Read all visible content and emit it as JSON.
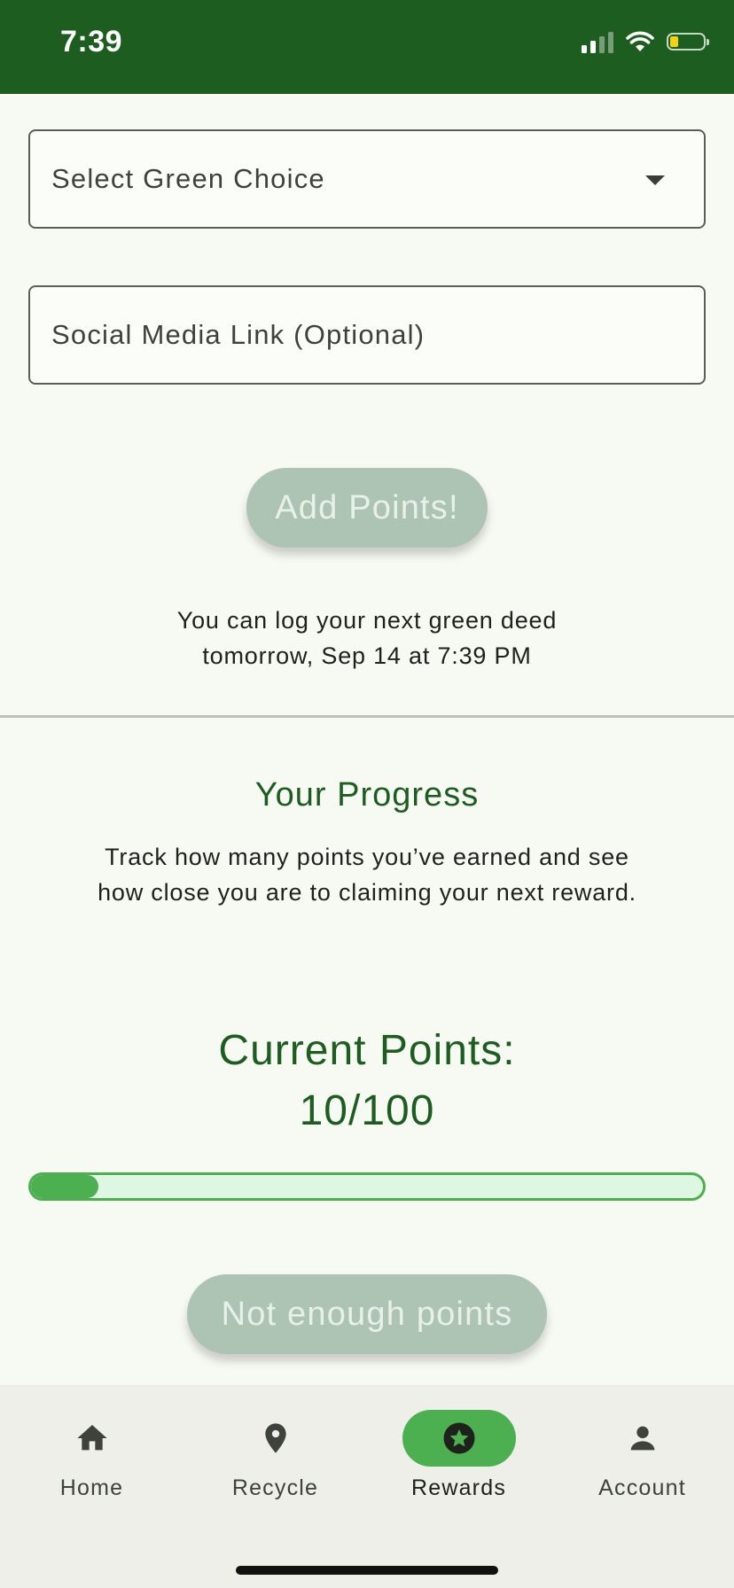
{
  "status_bar": {
    "time": "7:39",
    "icons": [
      "cellular-signal-icon",
      "wifi-icon",
      "battery-icon"
    ],
    "background": "#1d5e20"
  },
  "form": {
    "select_placeholder": "Select Green Choice",
    "link_placeholder": "Social Media Link (Optional)",
    "add_points_label": "Add Points!",
    "next_deed_line1": "You can log your next green deed",
    "next_deed_line2": "tomorrow, Sep 14 at 7:39 PM"
  },
  "progress": {
    "title": "Your Progress",
    "description": "Track how many points you’ve earned and see how close you are to claiming your next reward.",
    "points_heading": "Current Points:",
    "points_value": "10/100",
    "current_points": 10,
    "max_points": 100,
    "claim_label": "Not enough points"
  },
  "bottom_nav": {
    "items": [
      {
        "label": "Home",
        "icon": "home-icon",
        "active": false
      },
      {
        "label": "Recycle",
        "icon": "location-pin-icon",
        "active": false
      },
      {
        "label": "Rewards",
        "icon": "star-badge-icon",
        "active": true
      },
      {
        "label": "Account",
        "icon": "person-icon",
        "active": false
      }
    ]
  },
  "colors": {
    "primary_dark": "#1d5e20",
    "accent": "#4caf50",
    "disabled_button": "#adc4b4",
    "progress_track": "#ddf7e2"
  }
}
